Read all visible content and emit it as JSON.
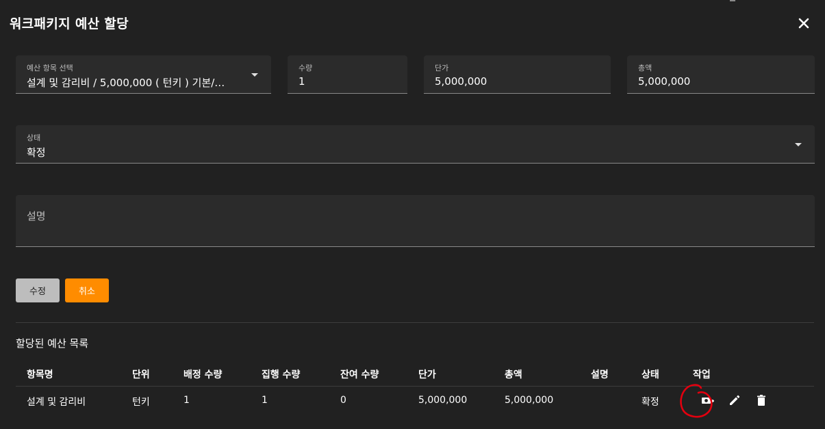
{
  "dialog": {
    "title": "워크패키지 예산 할당"
  },
  "form": {
    "budget_item": {
      "label": "예산 항목 선택",
      "value": "설계 및 감리비 / 5,000,000 ( 턴키 ) 기본/…"
    },
    "quantity": {
      "label": "수량",
      "value": "1"
    },
    "unit_price": {
      "label": "단가",
      "value": "5,000,000"
    },
    "total": {
      "label": "총액",
      "value": "5,000,000"
    },
    "status": {
      "label": "상태",
      "value": "확정"
    },
    "description": {
      "placeholder": "설명",
      "value": ""
    }
  },
  "buttons": {
    "edit": "수정",
    "cancel": "취소"
  },
  "list": {
    "title": "할당된 예산 목록",
    "columns": [
      "항목명",
      "단위",
      "배정 수량",
      "집행 수량",
      "잔여 수량",
      "단가",
      "총액",
      "설명",
      "상태",
      "작업"
    ],
    "rows": [
      {
        "name": "설계 및 감리비",
        "unit": "턴키",
        "allocated_qty": "1",
        "executed_qty": "1",
        "remaining_qty": "0",
        "unit_price": "5,000,000",
        "total": "5,000,000",
        "description": "",
        "status": "확정",
        "actions": [
          "execute-budget-icon",
          "pencil-icon",
          "trash-icon"
        ]
      }
    ]
  },
  "colors": {
    "background": "#212121",
    "field": "#2b2b2b",
    "accent": "#ff8c00",
    "annotation": "#e3000f"
  }
}
